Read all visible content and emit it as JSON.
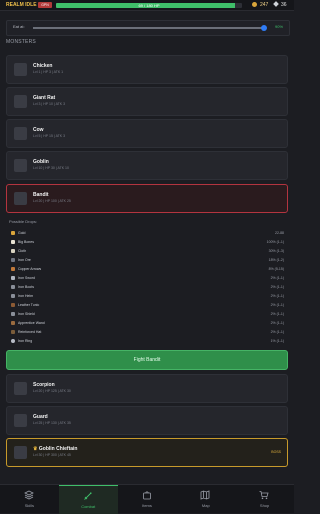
{
  "topbar": {
    "realm": "REALM IDLE",
    "badge": "GPN",
    "hp_text": "69 / 180 HP",
    "hp_fraction": 0.96,
    "coins": "247",
    "gems": "36"
  },
  "eat": {
    "label": "Eat at:",
    "value_text": "90%",
    "value_fraction": 0.9
  },
  "monsters_title": "MONSTERS",
  "monsters": [
    {
      "name": "Chicken",
      "stats": "Lvl 1 | HP 3 | ATK 1"
    },
    {
      "name": "Giant Rat",
      "stats": "Lvl 3 | HP 10 | ATK 3"
    },
    {
      "name": "Cow",
      "stats": "Lvl 5 | HP 15 | ATK 3"
    },
    {
      "name": "Goblin",
      "stats": "Lvl 10 | HP 30 | ATK 10"
    },
    {
      "name": "Bandit",
      "stats": "Lvl 20 | HP 100 | ATK 25"
    }
  ],
  "drops": {
    "title": "Possible Drops:",
    "items": [
      {
        "name": "Gold",
        "value": "22-88"
      },
      {
        "name": "Big Bones",
        "value": "100% (1-1)"
      },
      {
        "name": "Cloth",
        "value": "30% (1-3)"
      },
      {
        "name": "Iron Ore",
        "value": "18% (1-2)"
      },
      {
        "name": "Copper Arrows",
        "value": "8% (5-15)"
      },
      {
        "name": "Iron Sword",
        "value": "2% (1-1)"
      },
      {
        "name": "Iron Boots",
        "value": "2% (1-1)"
      },
      {
        "name": "Iron Helm",
        "value": "2% (1-1)"
      },
      {
        "name": "Leather Tunic",
        "value": "2% (1-1)"
      },
      {
        "name": "Iron Shield",
        "value": "2% (1-1)"
      },
      {
        "name": "Apprentice Wand",
        "value": "2% (1-1)"
      },
      {
        "name": "Reinforced Hat",
        "value": "2% (1-1)"
      },
      {
        "name": "Iron Ring",
        "value": "1% (1-1)"
      }
    ]
  },
  "fight_button": "Fight Bandit",
  "more_monsters": [
    {
      "name": "Scorpion",
      "stats": "Lvl 20 | HP 125 | ATK 30"
    },
    {
      "name": "Guard",
      "stats": "Lvl 25 | HP 130 | ATK 35"
    }
  ],
  "boss": {
    "name": "Goblin Chieftain",
    "stats": "Lvl 30 | HP 300 | ATK 45",
    "tag": "BOSS"
  },
  "nav": [
    {
      "label": "Skills",
      "icon": "layers-icon"
    },
    {
      "label": "Combat",
      "icon": "sword-icon"
    },
    {
      "label": "Items",
      "icon": "bag-icon"
    },
    {
      "label": "Map",
      "icon": "map-icon"
    },
    {
      "label": "Shop",
      "icon": "cart-icon"
    }
  ],
  "colors": {
    "accent": "#3fbf6a",
    "danger": "#b3343f",
    "boss": "#c79a2b"
  }
}
